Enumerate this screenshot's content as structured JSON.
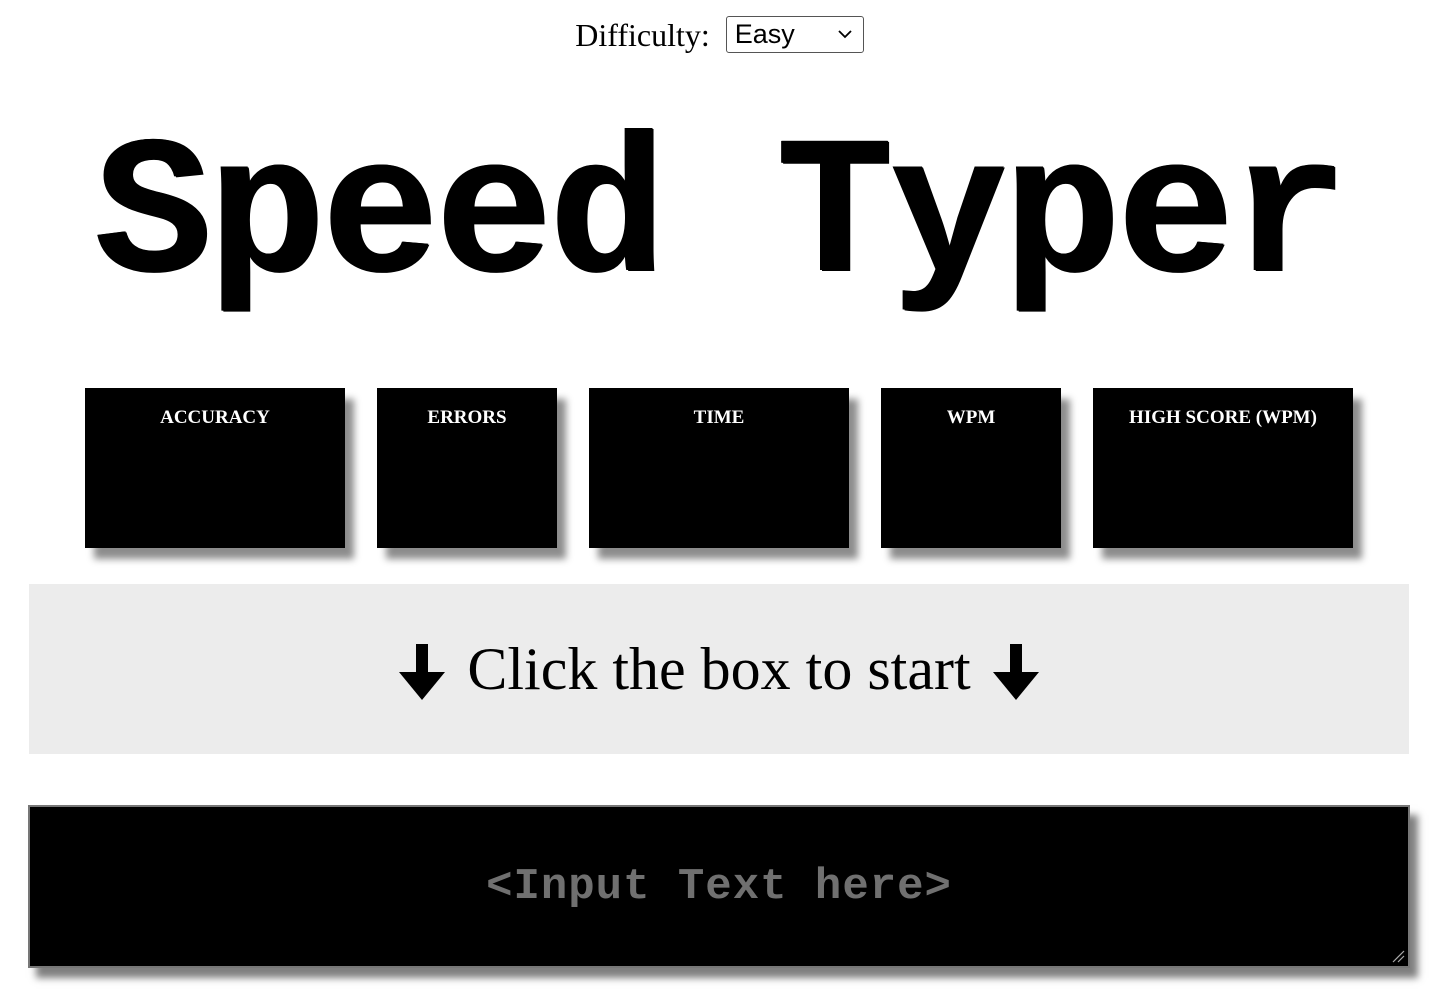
{
  "difficulty": {
    "label": "Difficulty:",
    "selected": "Easy"
  },
  "title": "Speed Typer",
  "stats": [
    {
      "label": "ACCURACY",
      "value": ""
    },
    {
      "label": "ERRORS",
      "value": ""
    },
    {
      "label": "TIME",
      "value": ""
    },
    {
      "label": "WPM",
      "value": ""
    },
    {
      "label": "HIGH SCORE (WPM)",
      "value": ""
    }
  ],
  "banner": {
    "text": "Click the box to start",
    "icon": "arrow-down-icon"
  },
  "input": {
    "placeholder": "<Input Text here>"
  },
  "colors": {
    "card_bg": "#000000",
    "banner_bg": "#ececec",
    "placeholder": "#707070"
  }
}
